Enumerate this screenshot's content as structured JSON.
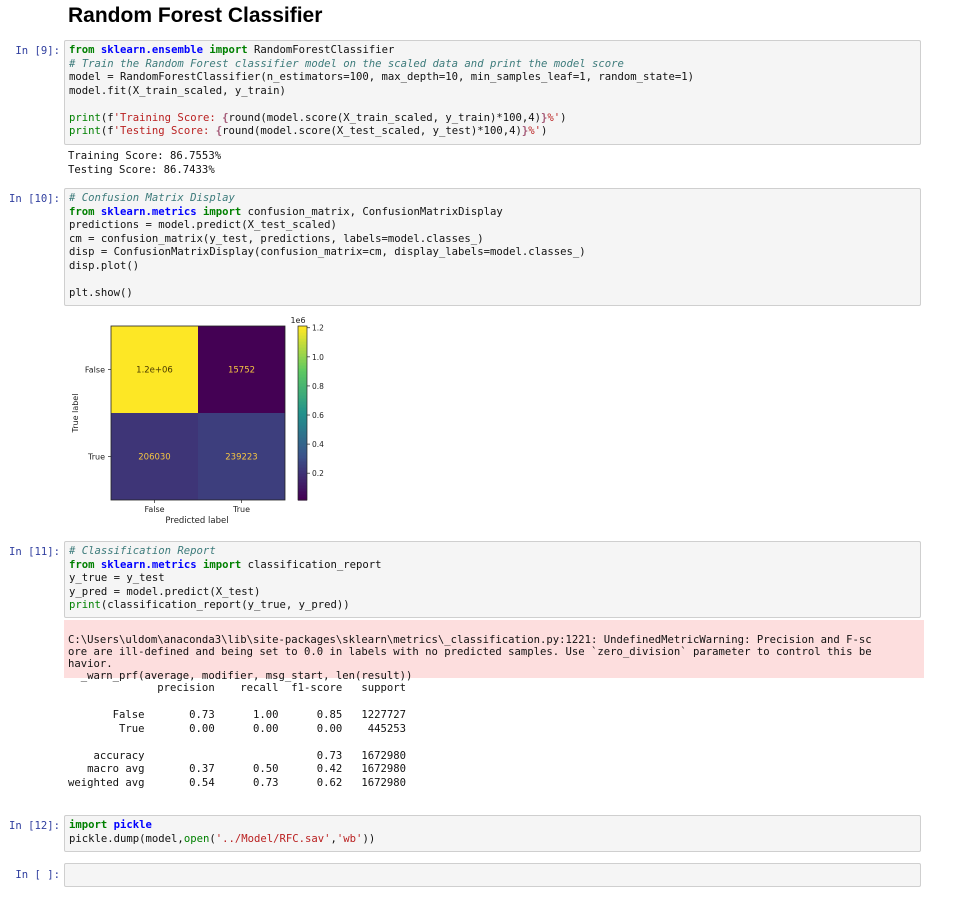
{
  "notebook": {
    "title": "Random Forest Classifier",
    "cells": [
      {
        "prompt": "In [9]:",
        "code": [
          [
            [
              "kw",
              "from"
            ],
            [
              "t",
              " "
            ],
            [
              "mod",
              "sklearn.ensemble"
            ],
            [
              "t",
              " "
            ],
            [
              "kw",
              "import"
            ],
            [
              "t",
              " RandomForestClassifier"
            ]
          ],
          [
            [
              "cm",
              "# Train the Random Forest classifier model on the scaled data and print the model score"
            ]
          ],
          [
            [
              "t",
              "model = RandomForestClassifier(n_estimators=100, max_depth=10, min_samples_leaf=1, random_state=1)"
            ]
          ],
          [
            [
              "t",
              "model.fit(X_train_scaled, y_train)"
            ]
          ],
          [
            [
              "t",
              ""
            ]
          ],
          [
            [
              "bi",
              "print"
            ],
            [
              "t",
              "(f"
            ],
            [
              "st",
              "'Training Score: "
            ],
            [
              "it",
              "{"
            ],
            [
              "t",
              "round(model.score(X_train_scaled, y_train)*100,4)"
            ],
            [
              "it",
              "}"
            ],
            [
              "st",
              "%'"
            ],
            [
              "t",
              ")"
            ]
          ],
          [
            [
              "bi",
              "print"
            ],
            [
              "t",
              "(f"
            ],
            [
              "st",
              "'Testing Score: "
            ],
            [
              "it",
              "{"
            ],
            [
              "t",
              "round(model.score(X_test_scaled, y_test)*100,4)"
            ],
            [
              "it",
              "}"
            ],
            [
              "st",
              "%'"
            ],
            [
              "t",
              ")"
            ]
          ]
        ],
        "output": "Training Score: 86.7553%\nTesting Score: 86.7433%"
      },
      {
        "prompt": "In [10]:",
        "code": [
          [
            [
              "cm",
              "# Confusion Matrix Display"
            ]
          ],
          [
            [
              "kw",
              "from"
            ],
            [
              "t",
              " "
            ],
            [
              "mod",
              "sklearn.metrics"
            ],
            [
              "t",
              " "
            ],
            [
              "kw",
              "import"
            ],
            [
              "t",
              " confusion_matrix, ConfusionMatrixDisplay"
            ]
          ],
          [
            [
              "t",
              "predictions = model.predict(X_test_scaled)"
            ]
          ],
          [
            [
              "t",
              "cm = confusion_matrix(y_test, predictions, labels=model.classes_)"
            ]
          ],
          [
            [
              "t",
              "disp = ConfusionMatrixDisplay(confusion_matrix=cm, display_labels=model.classes_)"
            ]
          ],
          [
            [
              "t",
              "disp.plot()"
            ]
          ],
          [
            [
              "t",
              ""
            ]
          ],
          [
            [
              "t",
              "plt.show()"
            ]
          ]
        ]
      },
      {
        "prompt": "In [11]:",
        "code": [
          [
            [
              "cm",
              "# Classification Report"
            ]
          ],
          [
            [
              "kw",
              "from"
            ],
            [
              "t",
              " "
            ],
            [
              "mod",
              "sklearn.metrics"
            ],
            [
              "t",
              " "
            ],
            [
              "kw",
              "import"
            ],
            [
              "t",
              " classification_report"
            ]
          ],
          [
            [
              "t",
              "y_true = y_test"
            ]
          ],
          [
            [
              "t",
              "y_pred = model.predict(X_test)"
            ]
          ],
          [
            [
              "bi",
              "print"
            ],
            [
              "t",
              "(classification_report(y_true, y_pred))"
            ]
          ]
        ],
        "warning": "C:\\Users\\uldom\\anaconda3\\lib\\site-packages\\sklearn\\metrics\\_classification.py:1221: UndefinedMetricWarning: Precision and F-sc\nore are ill-defined and being set to 0.0 in labels with no predicted samples. Use `zero_division` parameter to control this be\nhavior.\n  _warn_prf(average, modifier, msg_start, len(result))",
        "output": "              precision    recall  f1-score   support\n\n       False       0.73      1.00      0.85   1227727\n        True       0.00      0.00      0.00    445253\n\n    accuracy                           0.73   1672980\n   macro avg       0.37      0.50      0.42   1672980\nweighted avg       0.54      0.73      0.62   1672980"
      },
      {
        "prompt": "In [12]:",
        "code": [
          [
            [
              "kw",
              "import"
            ],
            [
              "t",
              " "
            ],
            [
              "mod",
              "pickle"
            ]
          ],
          [
            [
              "t",
              "pickle.dump(model,"
            ],
            [
              "bi",
              "open"
            ],
            [
              "t",
              "("
            ],
            [
              "st",
              "'../Model/RFC.sav'"
            ],
            [
              "t",
              ","
            ],
            [
              "st",
              "'wb'"
            ],
            [
              "t",
              "))"
            ]
          ]
        ]
      },
      {
        "prompt": "In [ ]:",
        "code": []
      }
    ]
  },
  "chart_data": {
    "type": "heatmap",
    "rows": [
      "False",
      "True"
    ],
    "columns": [
      "False",
      "True"
    ],
    "values": [
      [
        1212000,
        15752
      ],
      [
        206030,
        239223
      ]
    ],
    "cell_text": [
      [
        "1.2e+06",
        "15752"
      ],
      [
        "206030",
        "239223"
      ]
    ],
    "xlabel": "Predicted label",
    "ylabel": "True label",
    "colormap": "viridis",
    "colorbar": {
      "min": 15752,
      "max": 1212000,
      "ticks": [
        0.2,
        0.4,
        0.6,
        0.8,
        1.0,
        1.2
      ],
      "tick_labels": [
        "0.2",
        "0.4",
        "0.6",
        "0.8",
        "1.0",
        "1.2"
      ],
      "exponent": "1e6"
    },
    "annotation_colors": {
      "on_light": "#4a3a00",
      "on_dark": "#f5c542"
    }
  }
}
